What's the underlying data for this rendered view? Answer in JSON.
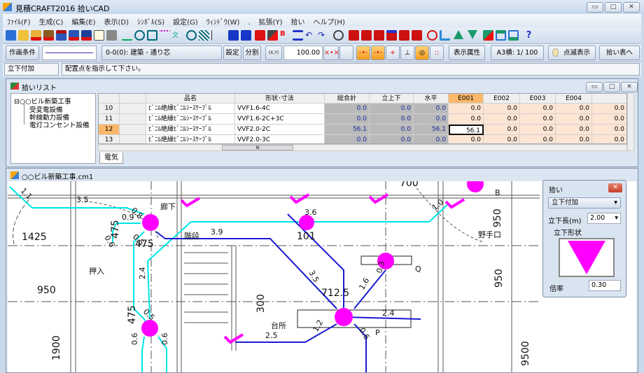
{
  "window": {
    "title": "見積CRAFT2016 拾いCAD",
    "minimize": "▭",
    "maximize": "□",
    "close": "✕"
  },
  "menu": [
    "ﾌｧｲﾙ(F)",
    "生成(C)",
    "編集(E)",
    "表示(D)",
    "ｼﾝﾎﾞﾙ(S)",
    "設定(G)",
    "ｳｨﾝﾄﾞｳ(W)",
    ".",
    "拡張(Y)",
    "拾い",
    "ヘルプ(H)"
  ],
  "toolbar2": {
    "drawing_conditions": "作画条件",
    "layer": "0-0(0): 建築 - 通り芯",
    "settings": "設定",
    "split": "分割",
    "scale_value": "100.00",
    "display_attr": "表示属性",
    "paper": "A3横: 1/ 100",
    "blink": "点滅表示",
    "to_sheet": "拾い表へ",
    "xy_label": "(X,Y)"
  },
  "status": {
    "mode": "立下付加",
    "message": "配置点を指示して下さい。"
  },
  "pick_list": {
    "title": "拾いリスト",
    "tree": {
      "root": "○○ビル新築工事",
      "children": [
        "受変電設備",
        "幹線動力設備",
        "電灯コンセント設備"
      ]
    },
    "columns": [
      "",
      "",
      "品名",
      "形状･寸法",
      "総合計",
      "立上下",
      "水平",
      "E001",
      "E002",
      "E003",
      "E004",
      ""
    ],
    "rows": [
      {
        "no": "10",
        "name": "ﾋﾞﾆﾙ絶縁ﾋﾞﾆﾙｼｰｽｹｰﾌﾞﾙ",
        "spec": "VVF1.6-4C",
        "total": "0.0",
        "updown": "0.0",
        "horiz": "0.0",
        "e001": "0.0",
        "e002": "0.0",
        "e003": "0.0",
        "e004": "0.0",
        "e005": "0.0"
      },
      {
        "no": "11",
        "name": "ﾋﾞﾆﾙ絶縁ﾋﾞﾆﾙｼｰｽｹｰﾌﾞﾙ",
        "spec": "VVF1.6-2C+3C",
        "total": "0.0",
        "updown": "0.0",
        "horiz": "0.0",
        "e001": "0.0",
        "e002": "0.0",
        "e003": "0.0",
        "e004": "0.0",
        "e005": "0.0"
      },
      {
        "no": "12",
        "name": "ﾋﾞﾆﾙ絶縁ﾋﾞﾆﾙｼｰｽｹｰﾌﾞﾙ",
        "spec": "VVF2.0-2C",
        "total": "56.1",
        "updown": "0.0",
        "horiz": "56.1",
        "e001": "56.1",
        "e002": "0.0",
        "e003": "0.0",
        "e004": "0.0",
        "e005": "0.0"
      },
      {
        "no": "13",
        "name": "ﾋﾞﾆﾙ絶縁ﾋﾞﾆﾙｼｰｽｹｰﾌﾞﾙ",
        "spec": "VVF2.0-3C",
        "total": "0.0",
        "updown": "0.0",
        "horiz": "0.0",
        "e001": "0.0",
        "e002": "0.0",
        "e003": "0.0",
        "e004": "0.0",
        "e005": "0.0"
      }
    ],
    "selected_row": "12",
    "selected_column": "E001",
    "tab": "電気",
    "hscroll_thumb": "III"
  },
  "cad": {
    "title": "○○ビル新築工事.cm1",
    "labels": [
      "1.1",
      "3.5",
      "0.8",
      "0.9",
      "0.6",
      "475",
      "0.5",
      "475",
      "1425",
      "廊下",
      "3.9",
      "階段",
      "押入",
      "950",
      "2.4",
      "0.5",
      "475",
      "0.6",
      "0.6",
      "1900",
      "300",
      "台所",
      "2.5",
      "3.6",
      "101",
      "3.5",
      "712.5",
      "1.6",
      "0.3",
      "Q",
      "2.4",
      "1.2",
      "0.6",
      "P",
      "1.0",
      "B",
      "950",
      "950",
      "9500",
      "野手口",
      "700"
    ]
  },
  "pick_panel": {
    "title": "拾い",
    "mode": "立下付加",
    "length_label": "立下長(m)",
    "length_value": "2.00",
    "shape_label": "立下形状",
    "ratio_label": "倍率",
    "ratio_value": "0.30",
    "shape_color": "#ff00ff"
  },
  "colors": {
    "accent": "#ff00ff",
    "cyan_wire": "#00e5e5",
    "blue_wire": "#1a1ad0",
    "selected": "#fbb86a"
  }
}
